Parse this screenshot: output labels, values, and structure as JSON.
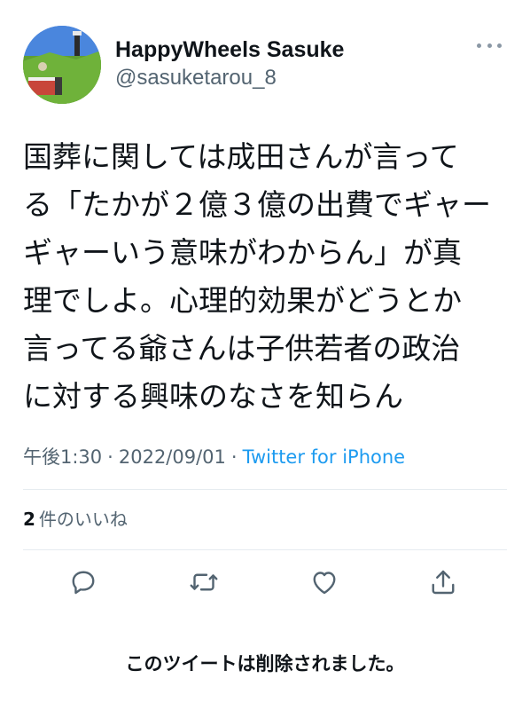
{
  "header": {
    "display_name": "HappyWheels Sasuke",
    "handle": "@sasuketarou_8",
    "avatar_icon": "game-scene-avatar",
    "more_icon": "more-dots-icon"
  },
  "tweet": {
    "text": "国葬に関しては成田さんが言って\nる「たかが２億３億の出費でギャー\nギャーいう意味がわからん」が真\n理でしよ。心理的効果がどうとか\n言ってる爺さんは子供若者の政治\nに対する興味のなさを知らん"
  },
  "meta": {
    "time": "午後1:30",
    "separator": "·",
    "date": "2022/09/01",
    "source": "Twitter for iPhone"
  },
  "likes": {
    "count": "2",
    "label": "件のいいね"
  },
  "actions": {
    "reply_icon": "reply-bubble-icon",
    "retweet_icon": "retweet-icon",
    "like_icon": "heart-icon",
    "share_icon": "share-upload-icon"
  },
  "notice": {
    "deleted_text": "このツイートは削除されました。"
  },
  "colors": {
    "text": "#0f1419",
    "secondary": "#536471",
    "accent": "#1d9bf0",
    "divider": "#e6ecf0"
  }
}
